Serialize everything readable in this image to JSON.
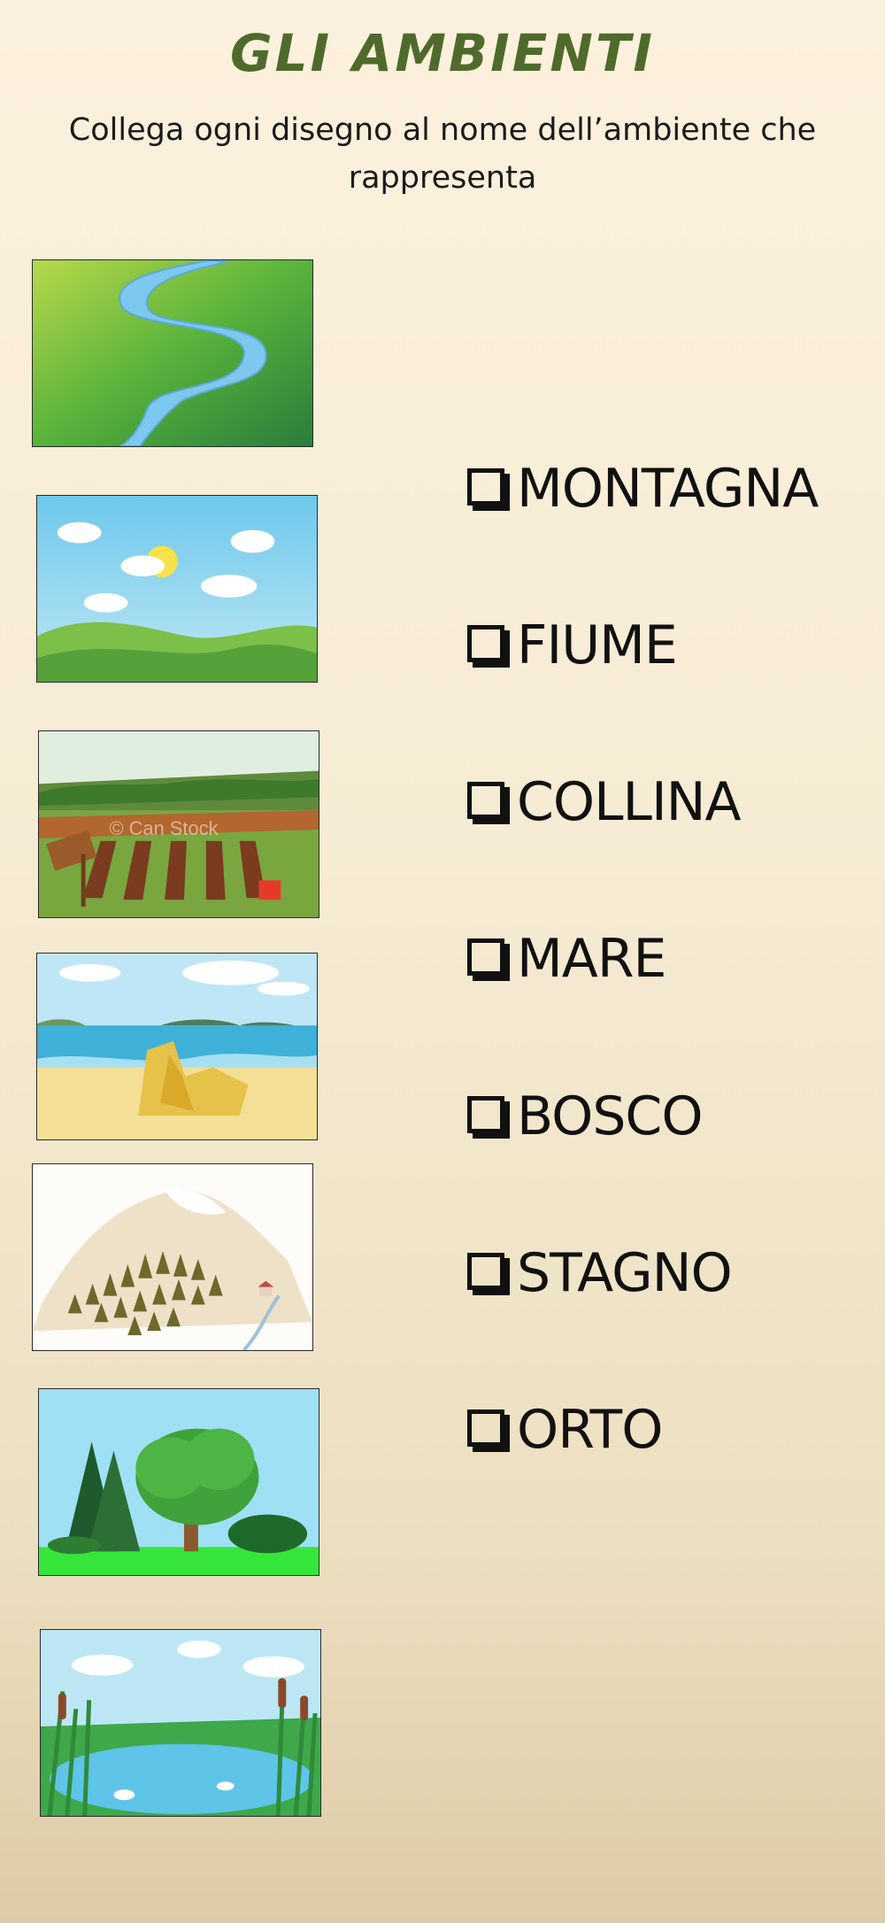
{
  "title": "GLI AMBIENTI",
  "subtitle": "Collega ogni disegno al nome dell’ambiente che rappresenta",
  "pictures": [
    {
      "name": "river-picture",
      "depicts": "fiume"
    },
    {
      "name": "hills-picture",
      "depicts": "collina"
    },
    {
      "name": "vegetable-garden-picture",
      "depicts": "orto",
      "watermark": "© Can Stock"
    },
    {
      "name": "sea-picture",
      "depicts": "mare"
    },
    {
      "name": "mountain-picture",
      "depicts": "montagna"
    },
    {
      "name": "forest-picture",
      "depicts": "bosco"
    },
    {
      "name": "pond-picture",
      "depicts": "stagno"
    }
  ],
  "options": [
    {
      "label": "MONTAGNA",
      "checked": false
    },
    {
      "label": "FIUME",
      "checked": false
    },
    {
      "label": "COLLINA",
      "checked": false
    },
    {
      "label": "MARE",
      "checked": false
    },
    {
      "label": "BOSCO",
      "checked": false
    },
    {
      "label": "STAGNO",
      "checked": false
    },
    {
      "label": "ORTO",
      "checked": false
    }
  ],
  "colors": {
    "title": "#4f6b2c",
    "text": "#111111",
    "background_top": "#fcf1de",
    "background_bottom": "#ddcba5"
  }
}
